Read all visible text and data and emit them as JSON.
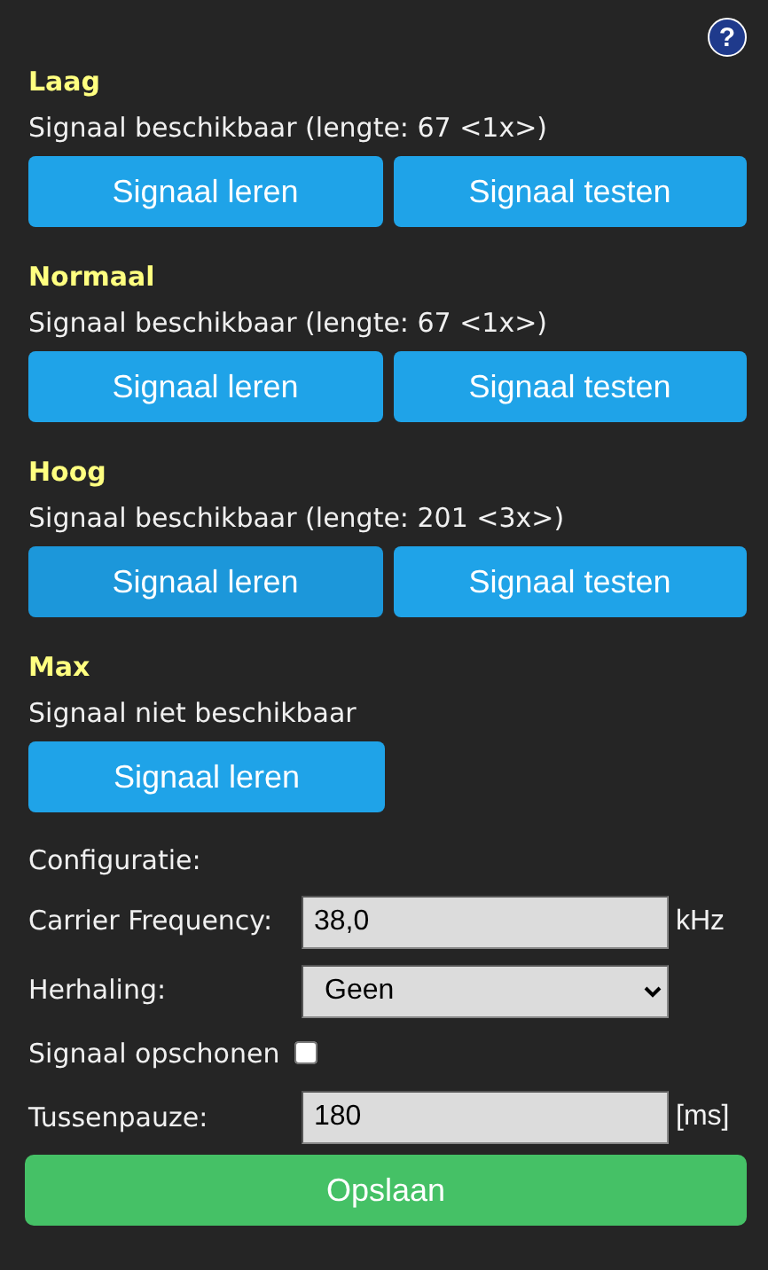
{
  "help": {
    "label": "?"
  },
  "signals": [
    {
      "title": "Laag",
      "status": "Signaal beschikbaar (lengte: 67 <1x>)",
      "buttons": [
        {
          "label": "Signaal leren",
          "hovered": false
        },
        {
          "label": "Signaal testen",
          "hovered": false
        }
      ]
    },
    {
      "title": "Normaal",
      "status": "Signaal beschikbaar (lengte: 67 <1x>)",
      "buttons": [
        {
          "label": "Signaal leren",
          "hovered": false
        },
        {
          "label": "Signaal testen",
          "hovered": false
        }
      ]
    },
    {
      "title": "Hoog",
      "status": "Signaal beschikbaar (lengte: 201 <3x>)",
      "buttons": [
        {
          "label": "Signaal leren",
          "hovered": true
        },
        {
          "label": "Signaal testen",
          "hovered": false
        }
      ]
    },
    {
      "title": "Max",
      "status": "Signaal niet beschikbaar",
      "buttons": [
        {
          "label": "Signaal leren",
          "hovered": false
        }
      ]
    }
  ],
  "configuration": {
    "heading": "Configuratie:",
    "fields": [
      {
        "kind": "text",
        "label": "Carrier Frequency:",
        "value": "38,0",
        "unit": "kHz"
      },
      {
        "kind": "select",
        "label": "Herhaling:",
        "value": "Geen"
      },
      {
        "kind": "checkbox",
        "label": "Signaal opschonen",
        "checked": false
      },
      {
        "kind": "text",
        "label": "Tussenpauze:",
        "value": "180",
        "unit": "[ms]"
      }
    ]
  },
  "save_button": {
    "label": "Opslaan"
  }
}
